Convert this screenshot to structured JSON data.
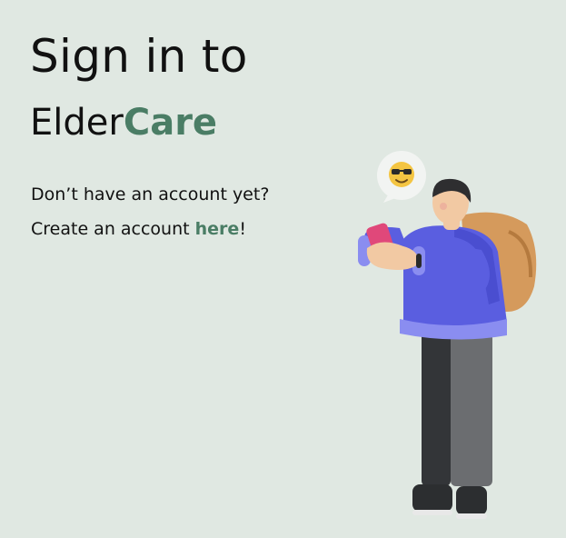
{
  "heading": {
    "line1": "Sign in to",
    "brand_prefix": "Elder",
    "brand_accent": "Care"
  },
  "signup_prompt": {
    "question": "Don’t have an account yet?",
    "create_prefix": "Create an account ",
    "link_text": "here",
    "suffix": "!"
  },
  "colors": {
    "background": "#e0e8e2",
    "accent": "#4a7d65",
    "text": "#111111"
  },
  "illustration": {
    "subject": "person-with-phone-and-backpack",
    "emoji": "sunglasses-emoji"
  }
}
